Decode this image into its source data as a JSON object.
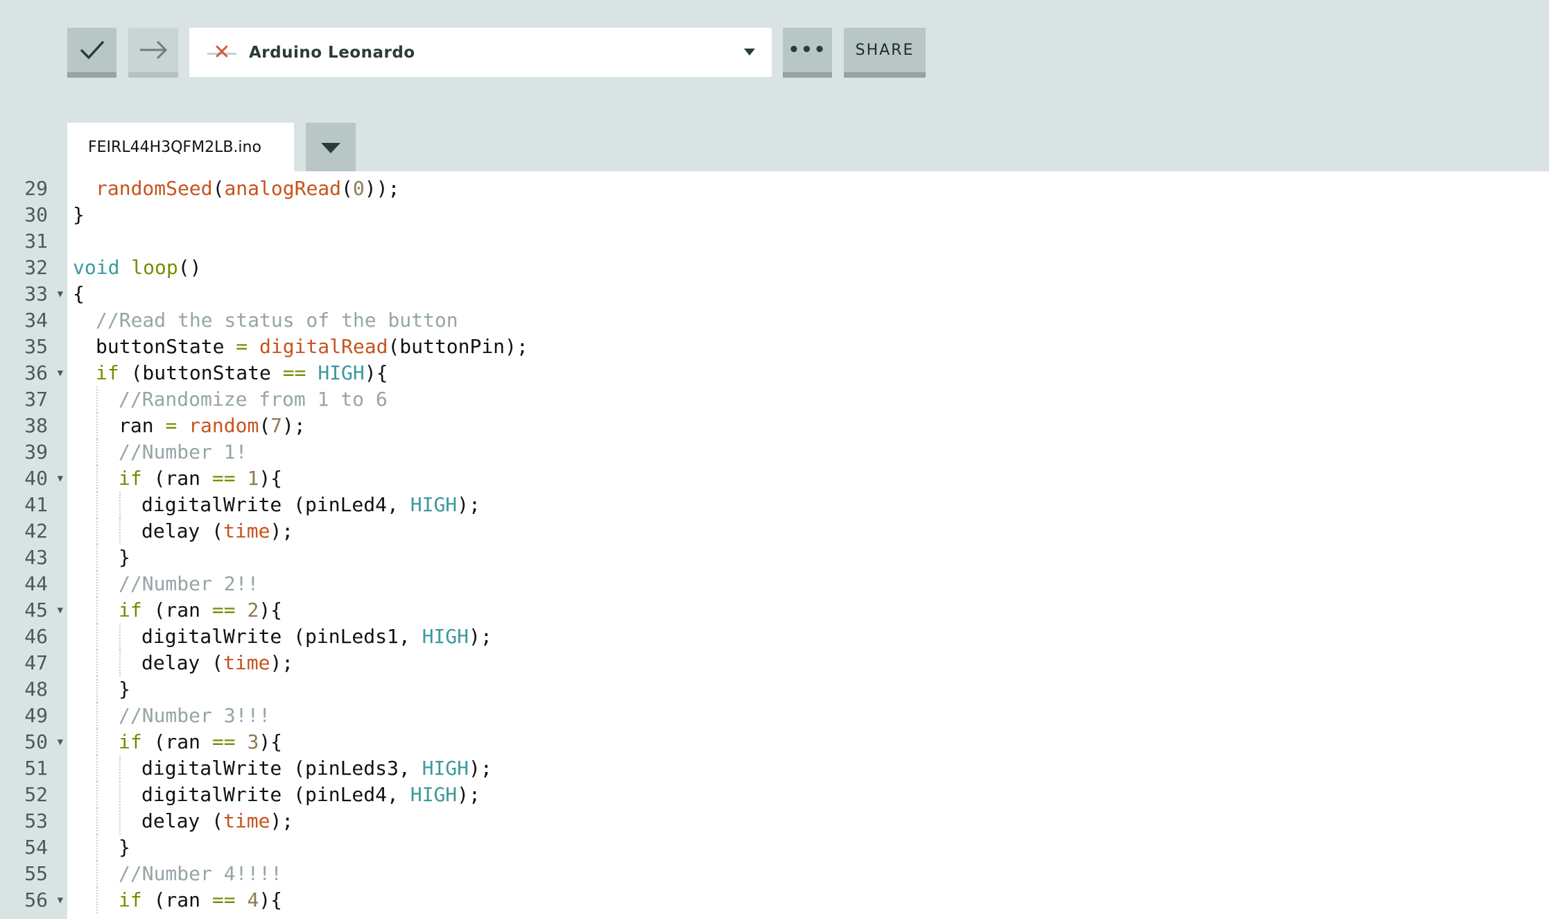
{
  "toolbar": {
    "verify_icon": "checkmark-icon",
    "upload_icon": "arrow-right-icon",
    "board": {
      "status_icon": "disconnected-x-icon",
      "name": "Arduino Leonardo"
    },
    "more_label": "•••",
    "share_label": "SHARE"
  },
  "tabs": {
    "file_name": "FEIRL44H3QFM2LB.ino"
  },
  "colors": {
    "background": "#dae3e3",
    "button": "#b9c6c6",
    "function": "#c7531c",
    "keyword": "#728e00",
    "constant": "#3a9a9d",
    "comment": "#95a5a6",
    "number": "#8a7b52"
  },
  "code": [
    {
      "n": "29",
      "i": 1,
      "t": [
        [
          "fn",
          "randomSeed"
        ],
        [
          "p",
          "("
        ],
        [
          "fn",
          "analogRead"
        ],
        [
          "p",
          "("
        ],
        [
          "nu",
          "0"
        ],
        [
          "p",
          "));"
        ]
      ]
    },
    {
      "n": "30",
      "i": 0,
      "t": [
        [
          "p",
          "}"
        ]
      ]
    },
    {
      "n": "31",
      "i": 0,
      "t": []
    },
    {
      "n": "32",
      "i": 0,
      "t": [
        [
          "ty",
          "void"
        ],
        [
          "p",
          " "
        ],
        [
          "kw",
          "loop"
        ],
        [
          "p",
          "()"
        ]
      ]
    },
    {
      "n": "33",
      "i": 0,
      "f": true,
      "t": [
        [
          "p",
          "{"
        ]
      ]
    },
    {
      "n": "34",
      "i": 1,
      "t": [
        [
          "cm",
          "//Read the status of the button"
        ]
      ]
    },
    {
      "n": "35",
      "i": 1,
      "t": [
        [
          "p",
          "buttonState "
        ],
        [
          "op",
          "="
        ],
        [
          "p",
          " "
        ],
        [
          "fn",
          "digitalRead"
        ],
        [
          "p",
          "(buttonPin);"
        ]
      ]
    },
    {
      "n": "36",
      "i": 1,
      "f": true,
      "t": [
        [
          "kw",
          "if"
        ],
        [
          "p",
          " (buttonState "
        ],
        [
          "op",
          "=="
        ],
        [
          "p",
          " "
        ],
        [
          "cn",
          "HIGH"
        ],
        [
          "p",
          "){"
        ]
      ]
    },
    {
      "n": "37",
      "i": 2,
      "t": [
        [
          "cm",
          "//Randomize from 1 to 6"
        ]
      ]
    },
    {
      "n": "38",
      "i": 2,
      "t": [
        [
          "p",
          "ran "
        ],
        [
          "op",
          "="
        ],
        [
          "p",
          " "
        ],
        [
          "fn",
          "random"
        ],
        [
          "p",
          "("
        ],
        [
          "nu",
          "7"
        ],
        [
          "p",
          ");"
        ]
      ]
    },
    {
      "n": "39",
      "i": 2,
      "t": [
        [
          "cm",
          "//Number 1!"
        ]
      ]
    },
    {
      "n": "40",
      "i": 2,
      "f": true,
      "t": [
        [
          "kw",
          "if"
        ],
        [
          "p",
          " (ran "
        ],
        [
          "op",
          "=="
        ],
        [
          "p",
          " "
        ],
        [
          "nu",
          "1"
        ],
        [
          "p",
          "){"
        ]
      ]
    },
    {
      "n": "41",
      "i": 3,
      "t": [
        [
          "p",
          "digitalWrite (pinLed4, "
        ],
        [
          "cn",
          "HIGH"
        ],
        [
          "p",
          ");"
        ]
      ]
    },
    {
      "n": "42",
      "i": 3,
      "t": [
        [
          "p",
          "delay ("
        ],
        [
          "fn",
          "time"
        ],
        [
          "p",
          ");"
        ]
      ]
    },
    {
      "n": "43",
      "i": 2,
      "t": [
        [
          "p",
          "}"
        ]
      ]
    },
    {
      "n": "44",
      "i": 2,
      "t": [
        [
          "cm",
          "//Number 2!!"
        ]
      ]
    },
    {
      "n": "45",
      "i": 2,
      "f": true,
      "t": [
        [
          "kw",
          "if"
        ],
        [
          "p",
          " (ran "
        ],
        [
          "op",
          "=="
        ],
        [
          "p",
          " "
        ],
        [
          "nu",
          "2"
        ],
        [
          "p",
          "){"
        ]
      ]
    },
    {
      "n": "46",
      "i": 3,
      "t": [
        [
          "p",
          "digitalWrite (pinLeds1, "
        ],
        [
          "cn",
          "HIGH"
        ],
        [
          "p",
          ");"
        ]
      ]
    },
    {
      "n": "47",
      "i": 3,
      "t": [
        [
          "p",
          "delay ("
        ],
        [
          "fn",
          "time"
        ],
        [
          "p",
          ");"
        ]
      ]
    },
    {
      "n": "48",
      "i": 2,
      "t": [
        [
          "p",
          "}"
        ]
      ]
    },
    {
      "n": "49",
      "i": 2,
      "t": [
        [
          "cm",
          "//Number 3!!!"
        ]
      ]
    },
    {
      "n": "50",
      "i": 2,
      "f": true,
      "t": [
        [
          "kw",
          "if"
        ],
        [
          "p",
          " (ran "
        ],
        [
          "op",
          "=="
        ],
        [
          "p",
          " "
        ],
        [
          "nu",
          "3"
        ],
        [
          "p",
          "){"
        ]
      ]
    },
    {
      "n": "51",
      "i": 3,
      "t": [
        [
          "p",
          "digitalWrite (pinLeds3, "
        ],
        [
          "cn",
          "HIGH"
        ],
        [
          "p",
          ");"
        ]
      ]
    },
    {
      "n": "52",
      "i": 3,
      "t": [
        [
          "p",
          "digitalWrite (pinLed4, "
        ],
        [
          "cn",
          "HIGH"
        ],
        [
          "p",
          ");"
        ]
      ]
    },
    {
      "n": "53",
      "i": 3,
      "t": [
        [
          "p",
          "delay ("
        ],
        [
          "fn",
          "time"
        ],
        [
          "p",
          ");"
        ]
      ]
    },
    {
      "n": "54",
      "i": 2,
      "t": [
        [
          "p",
          "}"
        ]
      ]
    },
    {
      "n": "55",
      "i": 2,
      "t": [
        [
          "cm",
          "//Number 4!!!!"
        ]
      ]
    },
    {
      "n": "56",
      "i": 2,
      "f": true,
      "t": [
        [
          "kw",
          "if"
        ],
        [
          "p",
          " (ran "
        ],
        [
          "op",
          "=="
        ],
        [
          "p",
          " "
        ],
        [
          "nu",
          "4"
        ],
        [
          "p",
          "){"
        ]
      ]
    }
  ]
}
